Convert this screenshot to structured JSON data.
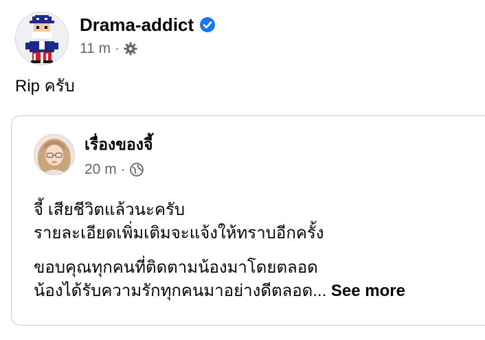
{
  "post": {
    "author": "Drama-addict",
    "time": "11 m",
    "separator": "·",
    "text": "Rip ครับ"
  },
  "shared_post": {
    "author": "เรื่องของจี้",
    "time": "20 m",
    "separator": "·",
    "line1": "จี้ เสียชีวิตแล้วนะครับ",
    "line2": "รายละเอียดเพิ่มเติมจะแจ้งให้ทราบอีกครั้ง",
    "line3": "ขอบคุณทุกคนที่ติดตามน้องมาโดยตลอด",
    "line4": "น้องได้รับความรักทุกคนมาอย่างดีตลอด...",
    "see_more": "See more"
  },
  "icons": {
    "verified": "verified-badge-icon",
    "privacy_post": "gear-icon",
    "privacy_shared": "globe-icon"
  },
  "colors": {
    "verified_blue": "#1877f2",
    "meta_gray": "#65676b",
    "card_border": "#c9ccd1"
  }
}
